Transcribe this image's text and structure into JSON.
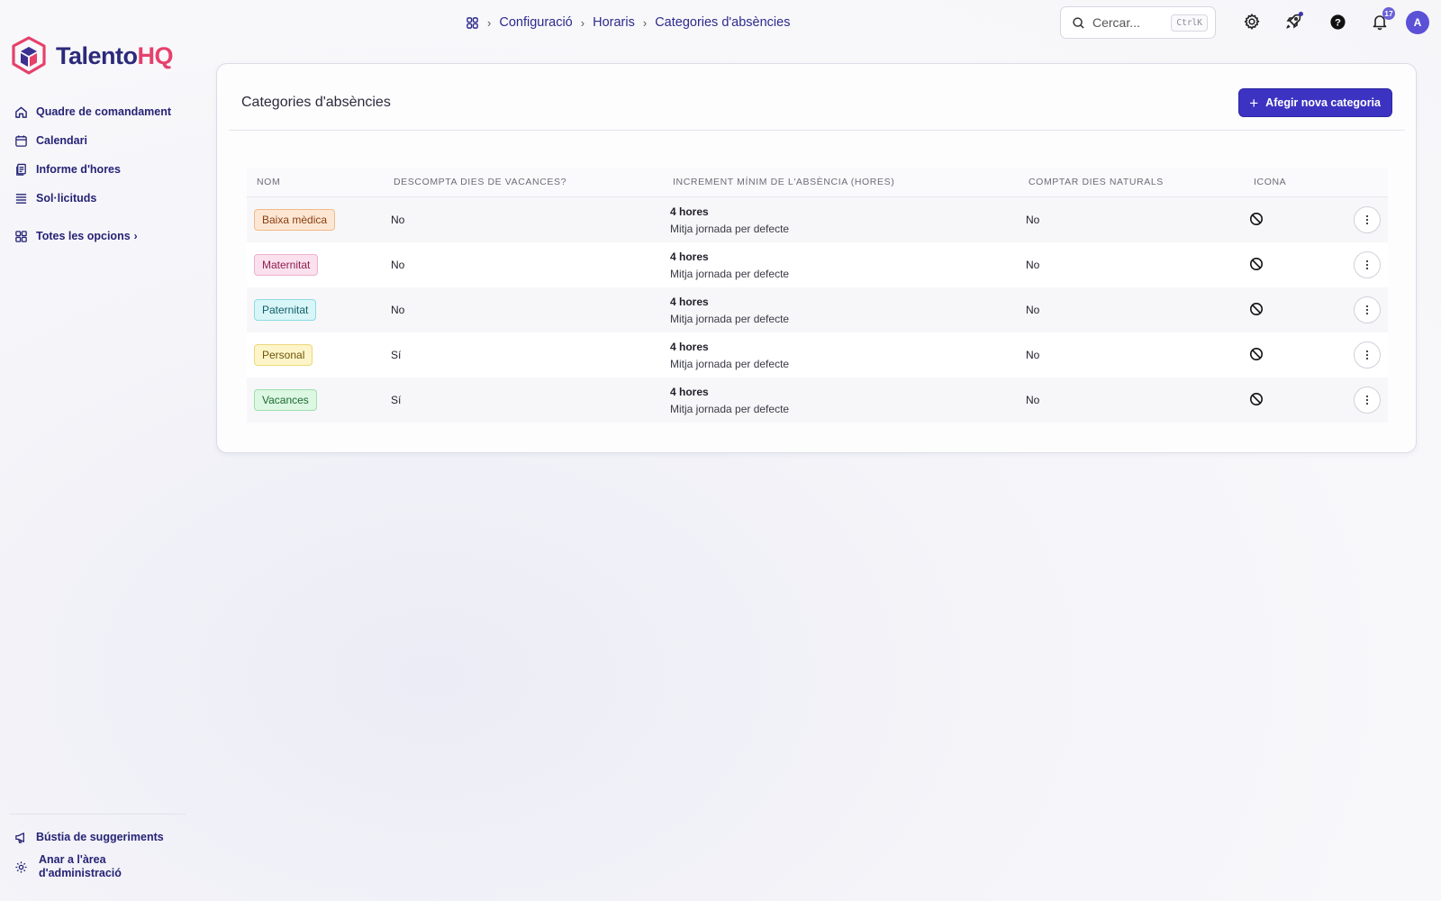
{
  "brand": {
    "name_part1": "Talento",
    "name_part2": "HQ"
  },
  "sidebar": {
    "items": [
      {
        "label": "Quadre de comandament",
        "icon": "home-icon"
      },
      {
        "label": "Calendari",
        "icon": "calendar-icon"
      },
      {
        "label": "Informe d'hores",
        "icon": "report-icon"
      },
      {
        "label": "Sol·licituds",
        "icon": "stack-icon"
      }
    ],
    "all_options": "Totes les opcions",
    "bottom": {
      "suggestions": "Bústia de suggeriments",
      "admin_line1": "Anar a l'àrea",
      "admin_line2": "d'administració"
    }
  },
  "breadcrumb": {
    "items": [
      "Configuració",
      "Horaris",
      "Categories d'absències"
    ]
  },
  "search": {
    "placeholder": "Cercar...",
    "shortcut": "CtrlK"
  },
  "notifications": {
    "count": "17"
  },
  "user": {
    "initial": "A"
  },
  "page": {
    "title": "Categories d'absències",
    "add_button": "Afegir nova categoria",
    "columns": [
      "NOM",
      "DESCOMPTA DIES DE VACANCES?",
      "INCREMENT MÍNIM DE L'ABSÈNCIA (HORES)",
      "COMPTAR DIES NATURALS",
      "ICONA"
    ],
    "rows": [
      {
        "name": "Baixa mèdica",
        "tag_bg": "#fde7d3",
        "tag_border": "#f1b98d",
        "tag_color": "#8a3c10",
        "discount": "No",
        "incr_main": "4 hores",
        "incr_sub": "Mitja jornada per defecte",
        "natural": "No",
        "icon": "no-entry-icon"
      },
      {
        "name": "Maternitat",
        "tag_bg": "#fbe1ee",
        "tag_border": "#eeb0cd",
        "tag_color": "#8d1f52",
        "discount": "No",
        "incr_main": "4 hores",
        "incr_sub": "Mitja jornada per defecte",
        "natural": "No",
        "icon": "no-entry-icon"
      },
      {
        "name": "Paternitat",
        "tag_bg": "#d8f5f7",
        "tag_border": "#8fdbe3",
        "tag_color": "#0f5f6a",
        "discount": "No",
        "incr_main": "4 hores",
        "incr_sub": "Mitja jornada per defecte",
        "natural": "No",
        "icon": "no-entry-icon"
      },
      {
        "name": "Personal",
        "tag_bg": "#fdf5c9",
        "tag_border": "#ecd87a",
        "tag_color": "#6d5406",
        "discount": "Sí",
        "incr_main": "4 hores",
        "incr_sub": "Mitja jornada per defecte",
        "natural": "No",
        "icon": "no-entry-icon"
      },
      {
        "name": "Vacances",
        "tag_bg": "#dcf7e2",
        "tag_border": "#9fe0ae",
        "tag_color": "#1c6a31",
        "discount": "Sí",
        "incr_main": "4 hores",
        "incr_sub": "Mitja jornada per defecte",
        "natural": "No",
        "icon": "no-entry-icon"
      }
    ]
  },
  "colors": {
    "accent": "#3c33c2",
    "brand_navy": "#2c2a7a",
    "brand_pink": "#e6416b"
  }
}
